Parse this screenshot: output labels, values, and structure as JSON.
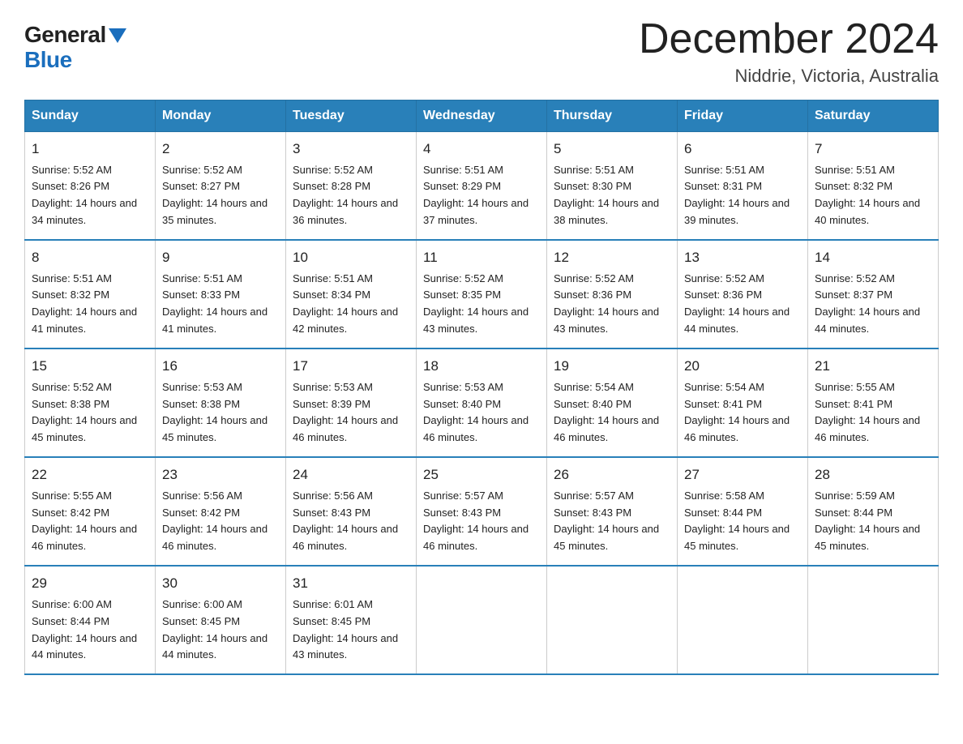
{
  "logo": {
    "general": "General",
    "blue": "Blue"
  },
  "header": {
    "month": "December 2024",
    "location": "Niddrie, Victoria, Australia"
  },
  "columns": [
    "Sunday",
    "Monday",
    "Tuesday",
    "Wednesday",
    "Thursday",
    "Friday",
    "Saturday"
  ],
  "weeks": [
    [
      {
        "day": "1",
        "sunrise": "5:52 AM",
        "sunset": "8:26 PM",
        "daylight": "14 hours and 34 minutes."
      },
      {
        "day": "2",
        "sunrise": "5:52 AM",
        "sunset": "8:27 PM",
        "daylight": "14 hours and 35 minutes."
      },
      {
        "day": "3",
        "sunrise": "5:52 AM",
        "sunset": "8:28 PM",
        "daylight": "14 hours and 36 minutes."
      },
      {
        "day": "4",
        "sunrise": "5:51 AM",
        "sunset": "8:29 PM",
        "daylight": "14 hours and 37 minutes."
      },
      {
        "day": "5",
        "sunrise": "5:51 AM",
        "sunset": "8:30 PM",
        "daylight": "14 hours and 38 minutes."
      },
      {
        "day": "6",
        "sunrise": "5:51 AM",
        "sunset": "8:31 PM",
        "daylight": "14 hours and 39 minutes."
      },
      {
        "day": "7",
        "sunrise": "5:51 AM",
        "sunset": "8:32 PM",
        "daylight": "14 hours and 40 minutes."
      }
    ],
    [
      {
        "day": "8",
        "sunrise": "5:51 AM",
        "sunset": "8:32 PM",
        "daylight": "14 hours and 41 minutes."
      },
      {
        "day": "9",
        "sunrise": "5:51 AM",
        "sunset": "8:33 PM",
        "daylight": "14 hours and 41 minutes."
      },
      {
        "day": "10",
        "sunrise": "5:51 AM",
        "sunset": "8:34 PM",
        "daylight": "14 hours and 42 minutes."
      },
      {
        "day": "11",
        "sunrise": "5:52 AM",
        "sunset": "8:35 PM",
        "daylight": "14 hours and 43 minutes."
      },
      {
        "day": "12",
        "sunrise": "5:52 AM",
        "sunset": "8:36 PM",
        "daylight": "14 hours and 43 minutes."
      },
      {
        "day": "13",
        "sunrise": "5:52 AM",
        "sunset": "8:36 PM",
        "daylight": "14 hours and 44 minutes."
      },
      {
        "day": "14",
        "sunrise": "5:52 AM",
        "sunset": "8:37 PM",
        "daylight": "14 hours and 44 minutes."
      }
    ],
    [
      {
        "day": "15",
        "sunrise": "5:52 AM",
        "sunset": "8:38 PM",
        "daylight": "14 hours and 45 minutes."
      },
      {
        "day": "16",
        "sunrise": "5:53 AM",
        "sunset": "8:38 PM",
        "daylight": "14 hours and 45 minutes."
      },
      {
        "day": "17",
        "sunrise": "5:53 AM",
        "sunset": "8:39 PM",
        "daylight": "14 hours and 46 minutes."
      },
      {
        "day": "18",
        "sunrise": "5:53 AM",
        "sunset": "8:40 PM",
        "daylight": "14 hours and 46 minutes."
      },
      {
        "day": "19",
        "sunrise": "5:54 AM",
        "sunset": "8:40 PM",
        "daylight": "14 hours and 46 minutes."
      },
      {
        "day": "20",
        "sunrise": "5:54 AM",
        "sunset": "8:41 PM",
        "daylight": "14 hours and 46 minutes."
      },
      {
        "day": "21",
        "sunrise": "5:55 AM",
        "sunset": "8:41 PM",
        "daylight": "14 hours and 46 minutes."
      }
    ],
    [
      {
        "day": "22",
        "sunrise": "5:55 AM",
        "sunset": "8:42 PM",
        "daylight": "14 hours and 46 minutes."
      },
      {
        "day": "23",
        "sunrise": "5:56 AM",
        "sunset": "8:42 PM",
        "daylight": "14 hours and 46 minutes."
      },
      {
        "day": "24",
        "sunrise": "5:56 AM",
        "sunset": "8:43 PM",
        "daylight": "14 hours and 46 minutes."
      },
      {
        "day": "25",
        "sunrise": "5:57 AM",
        "sunset": "8:43 PM",
        "daylight": "14 hours and 46 minutes."
      },
      {
        "day": "26",
        "sunrise": "5:57 AM",
        "sunset": "8:43 PM",
        "daylight": "14 hours and 45 minutes."
      },
      {
        "day": "27",
        "sunrise": "5:58 AM",
        "sunset": "8:44 PM",
        "daylight": "14 hours and 45 minutes."
      },
      {
        "day": "28",
        "sunrise": "5:59 AM",
        "sunset": "8:44 PM",
        "daylight": "14 hours and 45 minutes."
      }
    ],
    [
      {
        "day": "29",
        "sunrise": "6:00 AM",
        "sunset": "8:44 PM",
        "daylight": "14 hours and 44 minutes."
      },
      {
        "day": "30",
        "sunrise": "6:00 AM",
        "sunset": "8:45 PM",
        "daylight": "14 hours and 44 minutes."
      },
      {
        "day": "31",
        "sunrise": "6:01 AM",
        "sunset": "8:45 PM",
        "daylight": "14 hours and 43 minutes."
      },
      null,
      null,
      null,
      null
    ]
  ]
}
